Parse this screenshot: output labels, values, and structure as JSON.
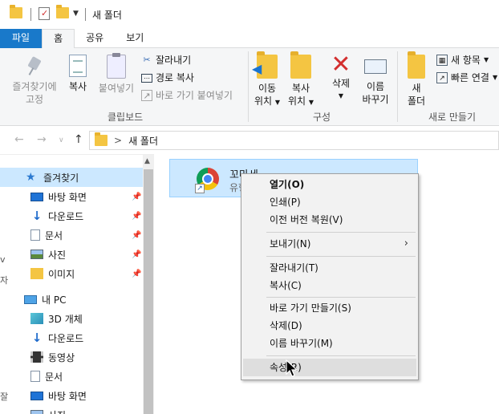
{
  "window": {
    "title": "새 폴더"
  },
  "ribbon_tabs": [
    "파일",
    "홈",
    "공유",
    "보기"
  ],
  "ribbon": {
    "clipboard": {
      "pin_label_1": "즐겨찾기에",
      "pin_label_2": "고정",
      "copy": "복사",
      "paste": "붙여넣기",
      "cut": "잘라내기",
      "copy_path": "경로 복사",
      "paste_shortcut": "바로 가기 붙여넣기",
      "group": "클립보드"
    },
    "organize": {
      "move_1": "이동",
      "move_2": "위치",
      "copy_1": "복사",
      "copy_2": "위치",
      "delete": "삭제",
      "rename_1": "이름",
      "rename_2": "바꾸기",
      "group": "구성"
    },
    "new": {
      "new_folder_1": "새",
      "new_folder_2": "폴더",
      "new_item": "새 항목",
      "easy_access": "빠른 연결",
      "group": "새로 만들기"
    }
  },
  "address": {
    "path": "새 폴더",
    "separator": ">"
  },
  "nav": {
    "items": [
      {
        "label": "즐겨찾기",
        "icon": "star-icon"
      },
      {
        "label": "바탕 화면",
        "icon": "desktop-icon"
      },
      {
        "label": "다운로드",
        "icon": "download-icon"
      },
      {
        "label": "문서",
        "icon": "document-icon"
      },
      {
        "label": "사진",
        "icon": "pictures-icon"
      },
      {
        "label": "이미지",
        "icon": "folder-icon"
      },
      {
        "label": "내 PC",
        "icon": "pc-icon"
      },
      {
        "label": "3D 개체",
        "icon": "3d-objects-icon"
      },
      {
        "label": "다운로드",
        "icon": "download-icon"
      },
      {
        "label": "동영상",
        "icon": "video-icon"
      },
      {
        "label": "문서",
        "icon": "document-icon"
      },
      {
        "label": "바탕 화면",
        "icon": "desktop-icon"
      },
      {
        "label": "사진",
        "icon": "pictures-icon"
      }
    ]
  },
  "file": {
    "name": "꼬마세",
    "type": "유형"
  },
  "left_edge": [
    "v",
    "자",
    "잘"
  ],
  "context_menu": {
    "open": "열기(O)",
    "print": "인쇄(P)",
    "restore": "이전 버전 복원(V)",
    "send_to": "보내기(N)",
    "cut": "잘라내기(T)",
    "copy": "복사(C)",
    "create_shortcut": "바로 가기 만들기(S)",
    "delete": "삭제(D)",
    "rename": "이름 바꾸기(M)",
    "properties": "속성(R)"
  },
  "colors": {
    "file_tab": "#1979ca",
    "selection": "#cce8ff",
    "delete_icon": "#d32f2f"
  }
}
